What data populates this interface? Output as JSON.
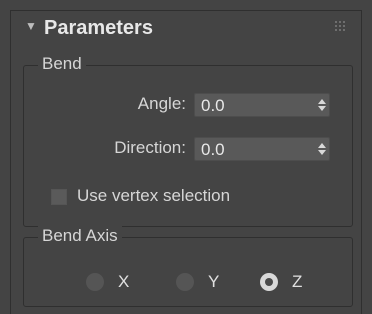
{
  "rollout": {
    "title": "Parameters",
    "collapse_icon": "triangle-down-icon",
    "grip_icon": "grip-dots-icon"
  },
  "bend": {
    "legend": "Bend",
    "angle_label": "Angle:",
    "angle_value": "0.0",
    "direction_label": "Direction:",
    "direction_value": "0.0",
    "use_vertex_selection_label": "Use vertex selection",
    "use_vertex_selection_checked": false
  },
  "bend_axis": {
    "legend": "Bend Axis",
    "options": [
      {
        "label": "X",
        "selected": false
      },
      {
        "label": "Y",
        "selected": false
      },
      {
        "label": "Z",
        "selected": true
      }
    ]
  },
  "colors": {
    "panel_bg": "#444444",
    "text": "#d6d6d6",
    "spinner_bg": "#595959",
    "border": "#2f2f2f"
  }
}
